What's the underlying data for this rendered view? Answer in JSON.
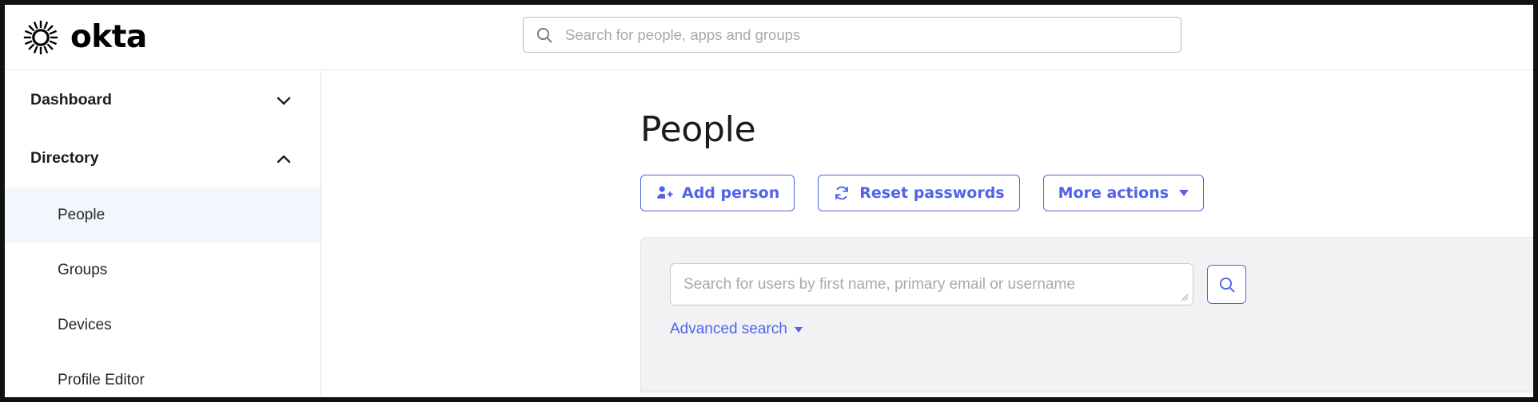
{
  "colors": {
    "accent_blue": "#5063e8",
    "active_nav_bg": "#f4f6fd",
    "panel_bg": "#f2f2f4",
    "text_dark": "#1b1b1f",
    "placeholder": "#a9a9b4"
  },
  "header": {
    "brand_name": "okta",
    "logo_icon": "okta-sunburst-logo",
    "global_search": {
      "icon": "search-icon",
      "placeholder": "Search for people, apps and groups",
      "value": ""
    }
  },
  "sidebar": {
    "sections": [
      {
        "label": "Dashboard",
        "expanded": false,
        "chevron_icon": "chevron-down-icon",
        "items": []
      },
      {
        "label": "Directory",
        "expanded": true,
        "chevron_icon": "chevron-up-icon",
        "items": [
          {
            "label": "People",
            "active": true
          },
          {
            "label": "Groups",
            "active": false
          },
          {
            "label": "Devices",
            "active": false
          },
          {
            "label": "Profile Editor",
            "active": false
          }
        ]
      }
    ]
  },
  "main": {
    "page_title": "People",
    "actions": [
      {
        "label": "Add person",
        "icon": "person-add-icon",
        "has_caret": false
      },
      {
        "label": "Reset passwords",
        "icon": "refresh-icon",
        "has_caret": false
      },
      {
        "label": "More actions",
        "icon": "",
        "has_caret": true
      }
    ],
    "search_panel": {
      "user_search": {
        "placeholder": "Search for users by first name, primary email or username",
        "value": "",
        "resize_handle": "resize-grip-icon"
      },
      "submit_icon": "search-icon",
      "advanced_search_label": "Advanced search",
      "advanced_search_caret": "caret-down-icon"
    }
  }
}
